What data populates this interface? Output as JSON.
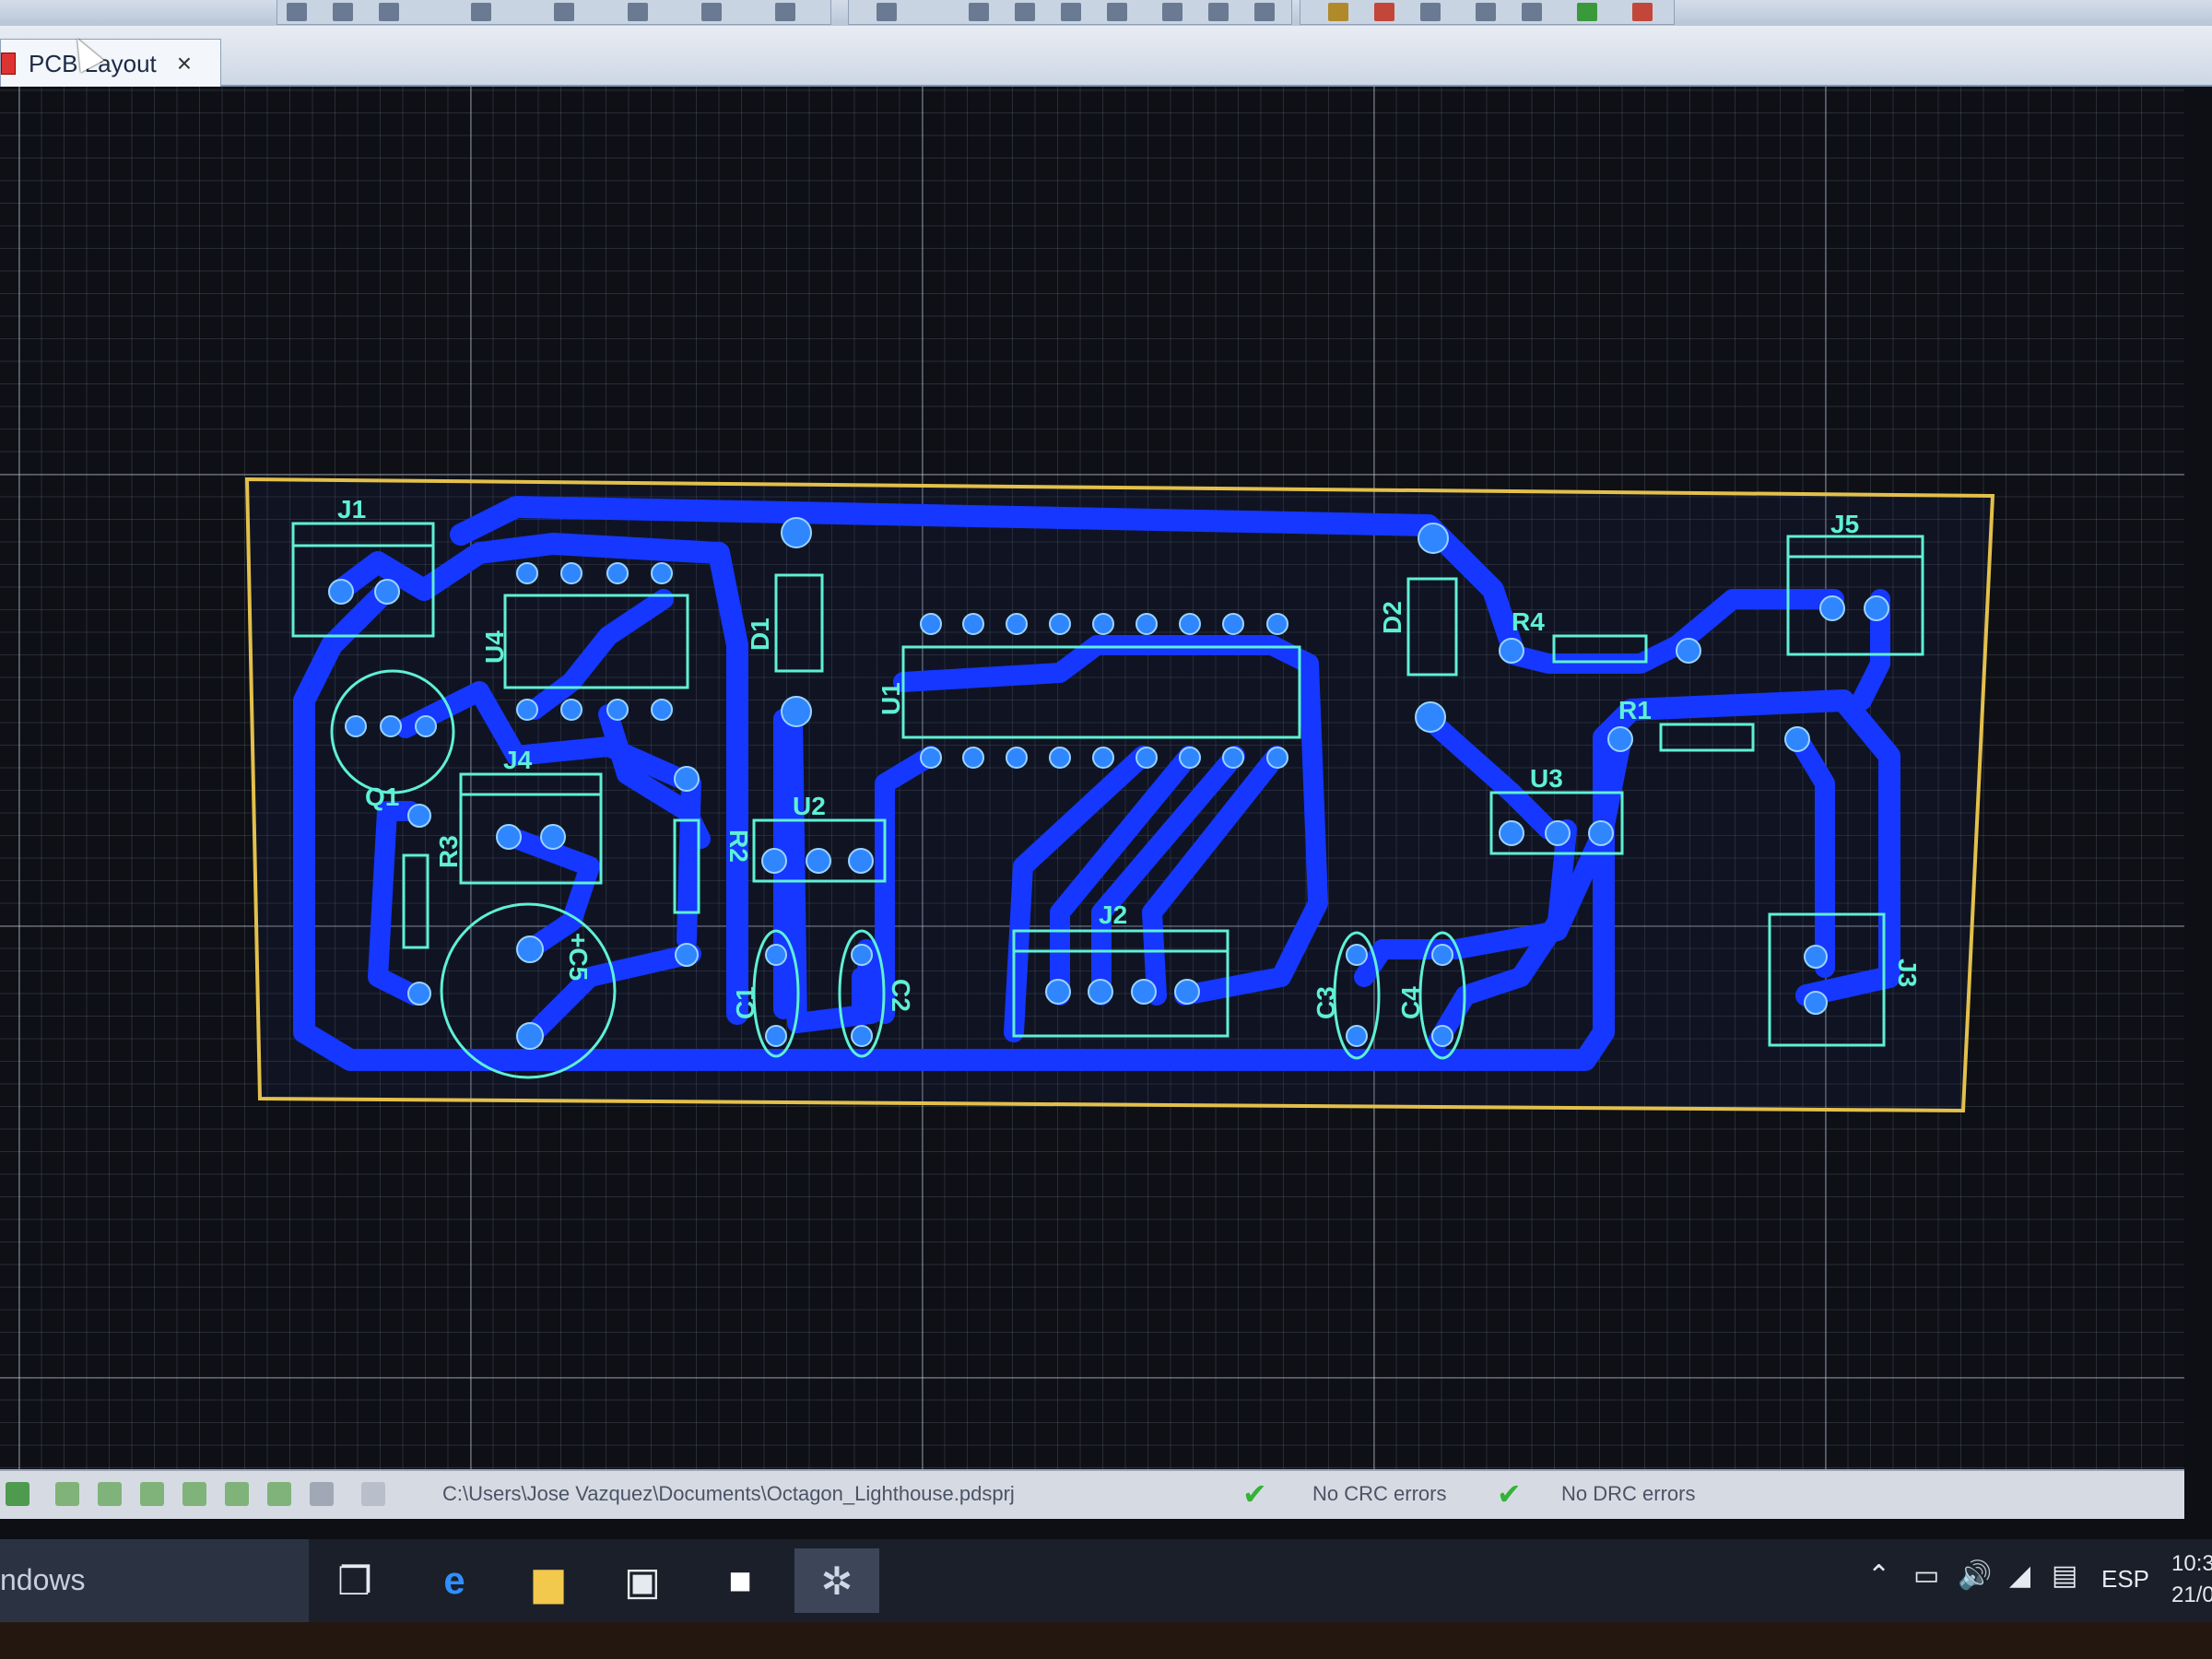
{
  "app": {
    "tab_label": "PCB Layout",
    "tab_close": "×"
  },
  "status": {
    "path": "C:\\Users\\Jose Vazquez\\Documents\\Octagon_Lighthouse.pdsprj",
    "crc": "No CRC errors",
    "drc": "No DRC errors"
  },
  "taskbar": {
    "start_text": "ndows",
    "lang": "ESP",
    "time": "10:3",
    "date": "21/0"
  },
  "components": {
    "J1": "J1",
    "J4": "J4",
    "J5": "J5",
    "J2": "J2",
    "J3": "J3",
    "U1": "U1",
    "U2": "U2",
    "U3": "U3",
    "U4": "U4",
    "D1": "D1",
    "D2": "D2",
    "R1": "R1",
    "R2": "R2",
    "R3": "R3",
    "R4": "R4",
    "C1": "C1",
    "C2": "C2",
    "C3": "C3",
    "C4": "C4",
    "C5": "+C5",
    "Q1": "Q1"
  },
  "colors": {
    "trace": "#1537ff",
    "pad": "#2f86ff",
    "silk": "#5ff0d5",
    "board_edge": "#e3c04b"
  }
}
